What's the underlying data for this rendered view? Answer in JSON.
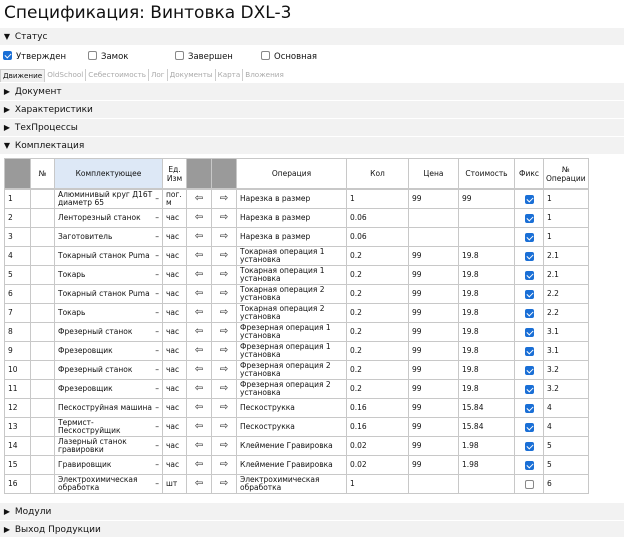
{
  "page": {
    "title": "Спецификация: Винтовка DXL-3"
  },
  "sections": {
    "status": "Статус",
    "document": "Документ",
    "characteristics": "Характеристики",
    "tech": "ТехПроцессы",
    "kit": "Комплектация",
    "modules": "Модули",
    "output": "Выход Продукции"
  },
  "status": {
    "approved": {
      "label": "Утвержден",
      "checked": true
    },
    "lock": {
      "label": "Замок",
      "checked": false
    },
    "done": {
      "label": "Завершен",
      "checked": false
    },
    "main": {
      "label": "Основная",
      "checked": false
    }
  },
  "tabs": [
    "Движение",
    "OldSchool",
    "Себестоимость",
    "Лог",
    "Документы",
    "Карта",
    "Вложения"
  ],
  "table": {
    "headers": {
      "num": "№",
      "component": "Комплектующее",
      "unit": "Ед. Изм",
      "operation": "Операция",
      "qty": "Кол",
      "price": "Цена",
      "cost": "Стоимость",
      "fix": "Фикс",
      "op_num": "№ Операции"
    },
    "rows": [
      {
        "n": "1",
        "component": "Алюминивый круг Д16Т диаметр 65",
        "unit": "пог. м",
        "op": "Нарезка в размер",
        "qty": "1",
        "price": "99",
        "cost": "99",
        "fix": true,
        "opn": "1"
      },
      {
        "n": "2",
        "component": "Ленторезный станок",
        "unit": "час",
        "op": "Нарезка в размер",
        "qty": "0.06",
        "price": "",
        "cost": "",
        "fix": true,
        "opn": "1"
      },
      {
        "n": "3",
        "component": "Заготовитель",
        "unit": "час",
        "op": "Нарезка в размер",
        "qty": "0.06",
        "price": "",
        "cost": "",
        "fix": true,
        "opn": "1"
      },
      {
        "n": "4",
        "component": "Токарный станок Puma",
        "unit": "час",
        "op": "Токарная операция 1 установка",
        "qty": "0.2",
        "price": "99",
        "cost": "19.8",
        "fix": true,
        "opn": "2.1"
      },
      {
        "n": "5",
        "component": "Токарь",
        "unit": "час",
        "op": "Токарная операция 1 установка",
        "qty": "0.2",
        "price": "99",
        "cost": "19.8",
        "fix": true,
        "opn": "2.1"
      },
      {
        "n": "6",
        "component": "Токарный станок Puma",
        "unit": "час",
        "op": "Токарная операция 2 установка",
        "qty": "0.2",
        "price": "99",
        "cost": "19.8",
        "fix": true,
        "opn": "2.2"
      },
      {
        "n": "7",
        "component": "Токарь",
        "unit": "час",
        "op": "Токарная операция 2 установка",
        "qty": "0.2",
        "price": "99",
        "cost": "19.8",
        "fix": true,
        "opn": "2.2"
      },
      {
        "n": "8",
        "component": "Фрезерный станок",
        "unit": "час",
        "op": "Фрезерная операция 1 установка",
        "qty": "0.2",
        "price": "99",
        "cost": "19.8",
        "fix": true,
        "opn": "3.1"
      },
      {
        "n": "9",
        "component": "Фрезеровщик",
        "unit": "час",
        "op": "Фрезерная операция 1 установка",
        "qty": "0.2",
        "price": "99",
        "cost": "19.8",
        "fix": true,
        "opn": "3.1"
      },
      {
        "n": "10",
        "component": "Фрезерный станок",
        "unit": "час",
        "op": "Фрезерная операция 2 установка",
        "qty": "0.2",
        "price": "99",
        "cost": "19.8",
        "fix": true,
        "opn": "3.2"
      },
      {
        "n": "11",
        "component": "Фрезеровщик",
        "unit": "час",
        "op": "Фрезерная операция 2 установка",
        "qty": "0.2",
        "price": "99",
        "cost": "19.8",
        "fix": true,
        "opn": "3.2"
      },
      {
        "n": "12",
        "component": "Пескоструйная машина",
        "unit": "час",
        "op": "Пескострукка",
        "qty": "0.16",
        "price": "99",
        "cost": "15.84",
        "fix": true,
        "opn": "4"
      },
      {
        "n": "13",
        "component": "Термист-Пескоструйщик",
        "unit": "час",
        "op": "Пескострукка",
        "qty": "0.16",
        "price": "99",
        "cost": "15.84",
        "fix": true,
        "opn": "4"
      },
      {
        "n": "14",
        "component": "Лазерный станок гравировки",
        "unit": "час",
        "op": "Клеймение Гравировка",
        "qty": "0.02",
        "price": "99",
        "cost": "1.98",
        "fix": true,
        "opn": "5"
      },
      {
        "n": "15",
        "component": "Гравировщик",
        "unit": "час",
        "op": "Клеймение Гравировка",
        "qty": "0.02",
        "price": "99",
        "cost": "1.98",
        "fix": true,
        "opn": "5"
      },
      {
        "n": "16",
        "component": "Электрохимическая обработка",
        "unit": "шт",
        "op": "Электрохимическая обработка",
        "qty": "1",
        "price": "",
        "cost": "",
        "fix": false,
        "opn": "6"
      }
    ]
  },
  "icons": {
    "in": "arrow-in-icon",
    "out": "arrow-out-icon",
    "dash": "–"
  }
}
